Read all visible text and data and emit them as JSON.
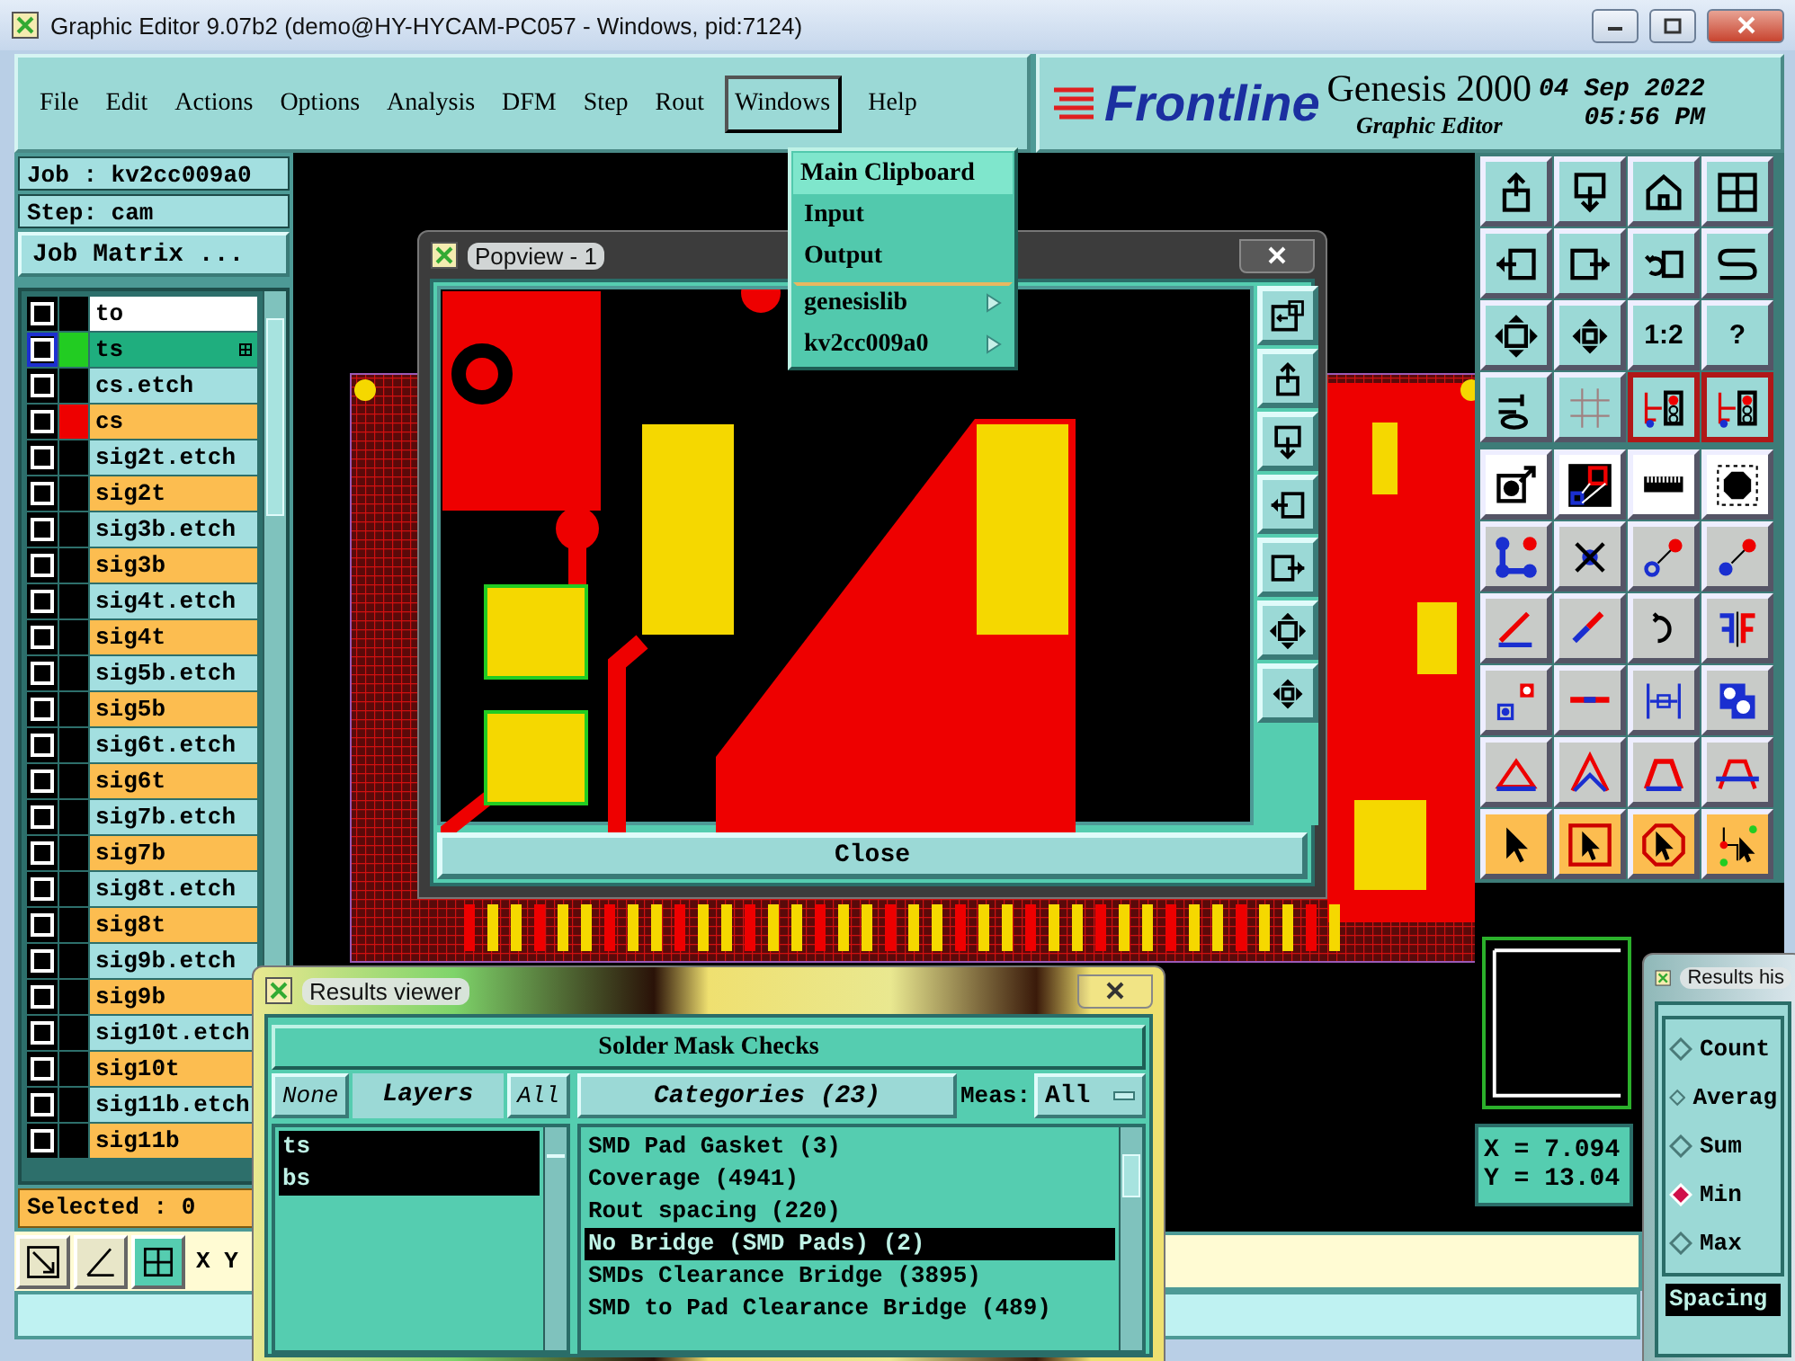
{
  "window": {
    "title": "Graphic Editor 9.07b2 (demo@HY-HYCAM-PC057 - Windows, pid:7124)"
  },
  "menu": [
    {
      "label": "File",
      "selected": false
    },
    {
      "label": "Edit",
      "selected": false
    },
    {
      "label": "Actions",
      "selected": false
    },
    {
      "label": "Options",
      "selected": false
    },
    {
      "label": "Analysis",
      "selected": false
    },
    {
      "label": "DFM",
      "selected": false
    },
    {
      "label": "Step",
      "selected": false
    },
    {
      "label": "Rout",
      "selected": false
    },
    {
      "label": "Windows",
      "selected": true
    },
    {
      "label": "Help",
      "selected": false
    }
  ],
  "brand": {
    "logo": "Frontline",
    "product": "Genesis 2000",
    "subtitle": "Graphic Editor",
    "date": "04 Sep 2022",
    "time": "05:56 PM"
  },
  "job": {
    "job": "Job : kv2cc009a0",
    "step": "Step: cam",
    "matrix_button": "Job Matrix ..."
  },
  "layers": [
    {
      "name": "to",
      "kind": "board",
      "checked": false,
      "selected": false
    },
    {
      "name": "ts",
      "kind": "mask",
      "checked": false,
      "selected": true,
      "color": "#22cc22"
    },
    {
      "name": "cs.etch",
      "kind": "etch",
      "checked": false,
      "selected": false
    },
    {
      "name": "cs",
      "kind": "signal",
      "checked": false,
      "selected": false,
      "color": "#ee0000"
    },
    {
      "name": "sig2t.etch",
      "kind": "etch",
      "checked": false,
      "selected": false
    },
    {
      "name": "sig2t",
      "kind": "signal",
      "checked": false,
      "selected": false
    },
    {
      "name": "sig3b.etch",
      "kind": "etch",
      "checked": false,
      "selected": false
    },
    {
      "name": "sig3b",
      "kind": "signal",
      "checked": false,
      "selected": false
    },
    {
      "name": "sig4t.etch",
      "kind": "etch",
      "checked": false,
      "selected": false
    },
    {
      "name": "sig4t",
      "kind": "signal",
      "checked": false,
      "selected": false
    },
    {
      "name": "sig5b.etch",
      "kind": "etch",
      "checked": false,
      "selected": false
    },
    {
      "name": "sig5b",
      "kind": "signal",
      "checked": false,
      "selected": false
    },
    {
      "name": "sig6t.etch",
      "kind": "etch",
      "checked": false,
      "selected": false
    },
    {
      "name": "sig6t",
      "kind": "signal",
      "checked": false,
      "selected": false
    },
    {
      "name": "sig7b.etch",
      "kind": "etch",
      "checked": false,
      "selected": false
    },
    {
      "name": "sig7b",
      "kind": "signal",
      "checked": false,
      "selected": false
    },
    {
      "name": "sig8t.etch",
      "kind": "etch",
      "checked": false,
      "selected": false
    },
    {
      "name": "sig8t",
      "kind": "signal",
      "checked": false,
      "selected": false
    },
    {
      "name": "sig9b.etch",
      "kind": "etch",
      "checked": false,
      "selected": false
    },
    {
      "name": "sig9b",
      "kind": "signal",
      "checked": false,
      "selected": false
    },
    {
      "name": "sig10t.etch",
      "kind": "etch",
      "checked": false,
      "selected": false
    },
    {
      "name": "sig10t",
      "kind": "signal",
      "checked": false,
      "selected": false
    },
    {
      "name": "sig11b.etch",
      "kind": "etch",
      "checked": false,
      "selected": false
    },
    {
      "name": "sig11b",
      "kind": "signal",
      "checked": false,
      "selected": false
    }
  ],
  "selected_count": "Selected : 0",
  "xy_label": "X Y",
  "toolbar": {
    "scale_label": "1:2",
    "help_label": "?"
  },
  "readout": [
    "X = 7.094",
    "Y = 13.04"
  ],
  "windows_menu": [
    {
      "label": "Main Clipboard",
      "kind": "item",
      "selected": true
    },
    {
      "label": "Input",
      "kind": "item",
      "selected": false
    },
    {
      "label": "Output",
      "kind": "item",
      "selected": false
    },
    {
      "label": "genesislib",
      "kind": "submenu",
      "selected": false
    },
    {
      "label": "kv2cc009a0",
      "kind": "submenu",
      "selected": false
    }
  ],
  "popview": {
    "title": "Popview - 1",
    "close_button": "Close"
  },
  "results_viewer": {
    "title": "Results viewer",
    "heading": "Solder Mask Checks",
    "none_button": "None",
    "layers_label": "Layers",
    "all_button": "All",
    "layers": [
      {
        "name": "ts",
        "selected": true
      },
      {
        "name": "bs",
        "selected": true
      }
    ],
    "categories_label": "Categories (23)",
    "meas_label": "Meas:",
    "meas_value": "All",
    "categories": [
      {
        "label": "SMD Pad Gasket (3)",
        "selected": false
      },
      {
        "label": "Coverage (4941)",
        "selected": false
      },
      {
        "label": "Rout spacing (220)",
        "selected": false
      },
      {
        "label": "No Bridge (SMD Pads) (2)",
        "selected": true
      },
      {
        "label": "SMDs Clearance Bridge (3895)",
        "selected": false
      },
      {
        "label": "SMD to Pad Clearance Bridge (489)",
        "selected": false
      }
    ]
  },
  "results_histogram": {
    "title": "Results his",
    "options": [
      {
        "label": "Count",
        "selected": false
      },
      {
        "label": "Averag",
        "selected": false
      },
      {
        "label": "Sum",
        "selected": false
      },
      {
        "label": "Min",
        "selected": true
      },
      {
        "label": "Max",
        "selected": false
      }
    ],
    "list": [
      {
        "label": "Spacing",
        "selected": true
      }
    ]
  }
}
